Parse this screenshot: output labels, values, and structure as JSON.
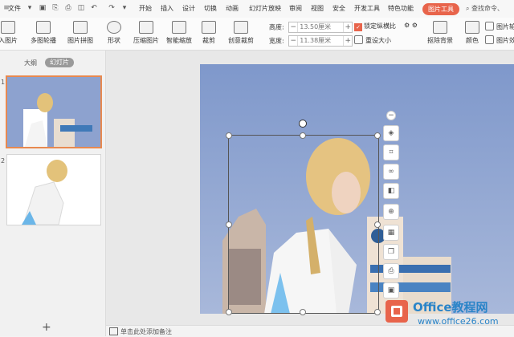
{
  "menubar": {
    "file": "文件",
    "tabs": [
      "开始",
      "插入",
      "设计",
      "切换",
      "动画",
      "幻灯片放映",
      "审阅",
      "视图",
      "安全",
      "开发工具",
      "特色功能"
    ],
    "active_tab": "图片工具",
    "search": "查找命令、"
  },
  "ribbon": {
    "insert_picture": "入图片",
    "multi_crop": "多图轮播",
    "picture_collage": "图片拼图",
    "shape": "形状",
    "compress": "压缩图片",
    "smart_zoom": "智能缩放",
    "crop": "裁剪",
    "creative_crop": "创意裁剪",
    "height_label": "高度:",
    "height_value": "13.50厘米",
    "width_label": "宽度:",
    "width_value": "11.38厘米",
    "lock_ratio": "锁定纵横比",
    "reset_size": "重设大小",
    "remove_bg": "抠除背景",
    "color": "颜色",
    "picture_outline": "图片轮",
    "picture_effect": "图片效"
  },
  "left_panel": {
    "tab_outline": "大纲",
    "tab_slides": "幻灯片",
    "slide_numbers": [
      "1",
      "2"
    ]
  },
  "notes": {
    "placeholder": "单击此处添加备注"
  },
  "watermark": {
    "title": "Office教程网",
    "url": "www.office26.com"
  },
  "colors": {
    "accent": "#e8644b",
    "sky": "#8da2cf",
    "watermark_blue": "#2a84c8"
  }
}
